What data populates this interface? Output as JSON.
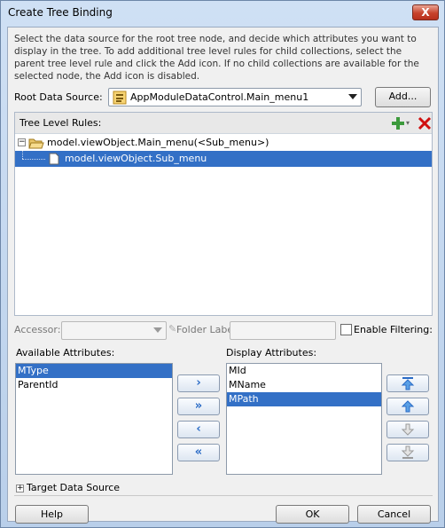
{
  "window": {
    "title": "Create Tree Binding",
    "close_glyph": "X"
  },
  "description": "Select the data source for the root tree node, and decide which attributes you want to display in the tree. To add additional tree level rules for child collections, select the parent tree level rule and click the Add icon. If no child collections are available for the selected node, the Add icon is disabled.",
  "root_source": {
    "label": "Root Data Source:",
    "value": "AppModuleDataControl.Main_menu1",
    "add_label": "Add..."
  },
  "tree_rules": {
    "label": "Tree Level Rules:",
    "nodes": [
      {
        "label": "model.viewObject.Main_menu(<Sub_menu>)",
        "expander": "−"
      },
      {
        "label": "model.viewObject.Sub_menu"
      }
    ]
  },
  "accessor": {
    "label": "Accessor:",
    "value": ""
  },
  "folder_label": {
    "label": "Folder Label:",
    "value": ""
  },
  "enable_filtering": {
    "label": "Enable Filtering:",
    "checked": false
  },
  "available": {
    "label": "Available Attributes:",
    "items": [
      "MType",
      "ParentId"
    ]
  },
  "display": {
    "label": "Display Attributes:",
    "items": [
      "MId",
      "MName",
      "MPath"
    ]
  },
  "shuttle": {
    "move": "›",
    "move_all": "»",
    "remove": "‹",
    "remove_all": "«"
  },
  "target_source": {
    "label": "Target Data Source",
    "expander": "+"
  },
  "buttons": {
    "help": "Help",
    "ok": "OK",
    "cancel": "Cancel"
  },
  "colors": {
    "selection": "#3370c6",
    "titlebar": "#c5d9f1",
    "delete_icon": "#d01010",
    "add_icon": "#3c9a3c"
  }
}
